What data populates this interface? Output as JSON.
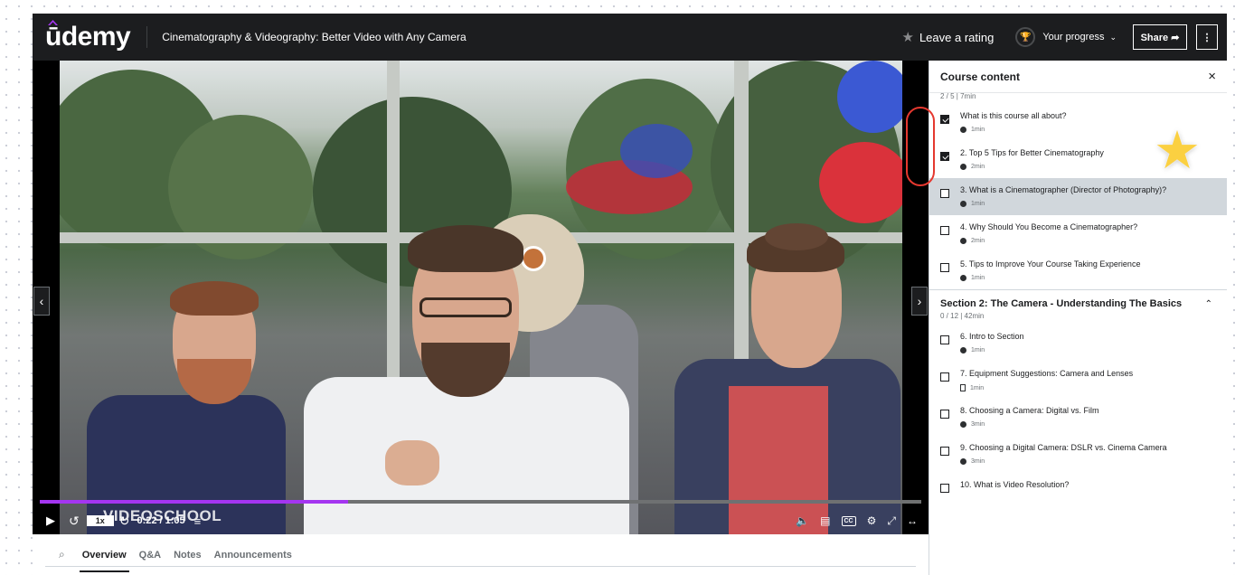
{
  "header": {
    "logo": "ūdemy",
    "course_title": "Cinematography & Videography: Better Video with Any Camera",
    "rating_label": "Leave a rating",
    "progress_label": "Your progress",
    "share_label": "Share ➦",
    "more_label": "⋮",
    "brand_color": "#a435f0"
  },
  "player": {
    "watermark": "VIDEOSCHOOL",
    "speed": "1x",
    "time": "0:22 / 1:05",
    "progress_fraction": 0.35,
    "cc_label": "CC",
    "prev_arrow": "‹",
    "next_arrow": "›"
  },
  "tabs": [
    {
      "label": "Overview"
    },
    {
      "label": "Q&A"
    },
    {
      "label": "Notes"
    },
    {
      "label": "Announcements"
    }
  ],
  "sidebar": {
    "title": "Course content",
    "close": "×",
    "section1_meta": "2 / 5 | 7min",
    "items_s1": [
      {
        "label": "What is this course all about?",
        "duration": "1min",
        "checked": true
      },
      {
        "label": "2. Top 5 Tips for Better Cinematography",
        "duration": "2min",
        "checked": true
      },
      {
        "label": "3. What is a Cinematographer (Director of Photography)?",
        "duration": "1min",
        "checked": false,
        "current": true
      },
      {
        "label": "4. Why Should You Become a Cinematographer?",
        "duration": "2min",
        "checked": false
      },
      {
        "label": "5. Tips to Improve Your Course Taking Experience",
        "duration": "1min",
        "checked": false
      }
    ],
    "section2": {
      "title": "Section 2: The Camera - Understanding The Basics",
      "meta": "0 / 12 | 42min",
      "chevron": "⌃"
    },
    "items_s2": [
      {
        "label": "6. Intro to Section",
        "duration": "1min",
        "type": "video"
      },
      {
        "label": "7. Equipment Suggestions: Camera and Lenses",
        "duration": "1min",
        "type": "doc"
      },
      {
        "label": "8. Choosing a Camera: Digital vs. Film",
        "duration": "3min",
        "type": "video"
      },
      {
        "label": "9. Choosing a Digital Camera: DSLR vs. Cinema Camera",
        "duration": "3min",
        "type": "video"
      },
      {
        "label": "10. What is Video Resolution?",
        "duration": "",
        "type": "video"
      }
    ]
  }
}
